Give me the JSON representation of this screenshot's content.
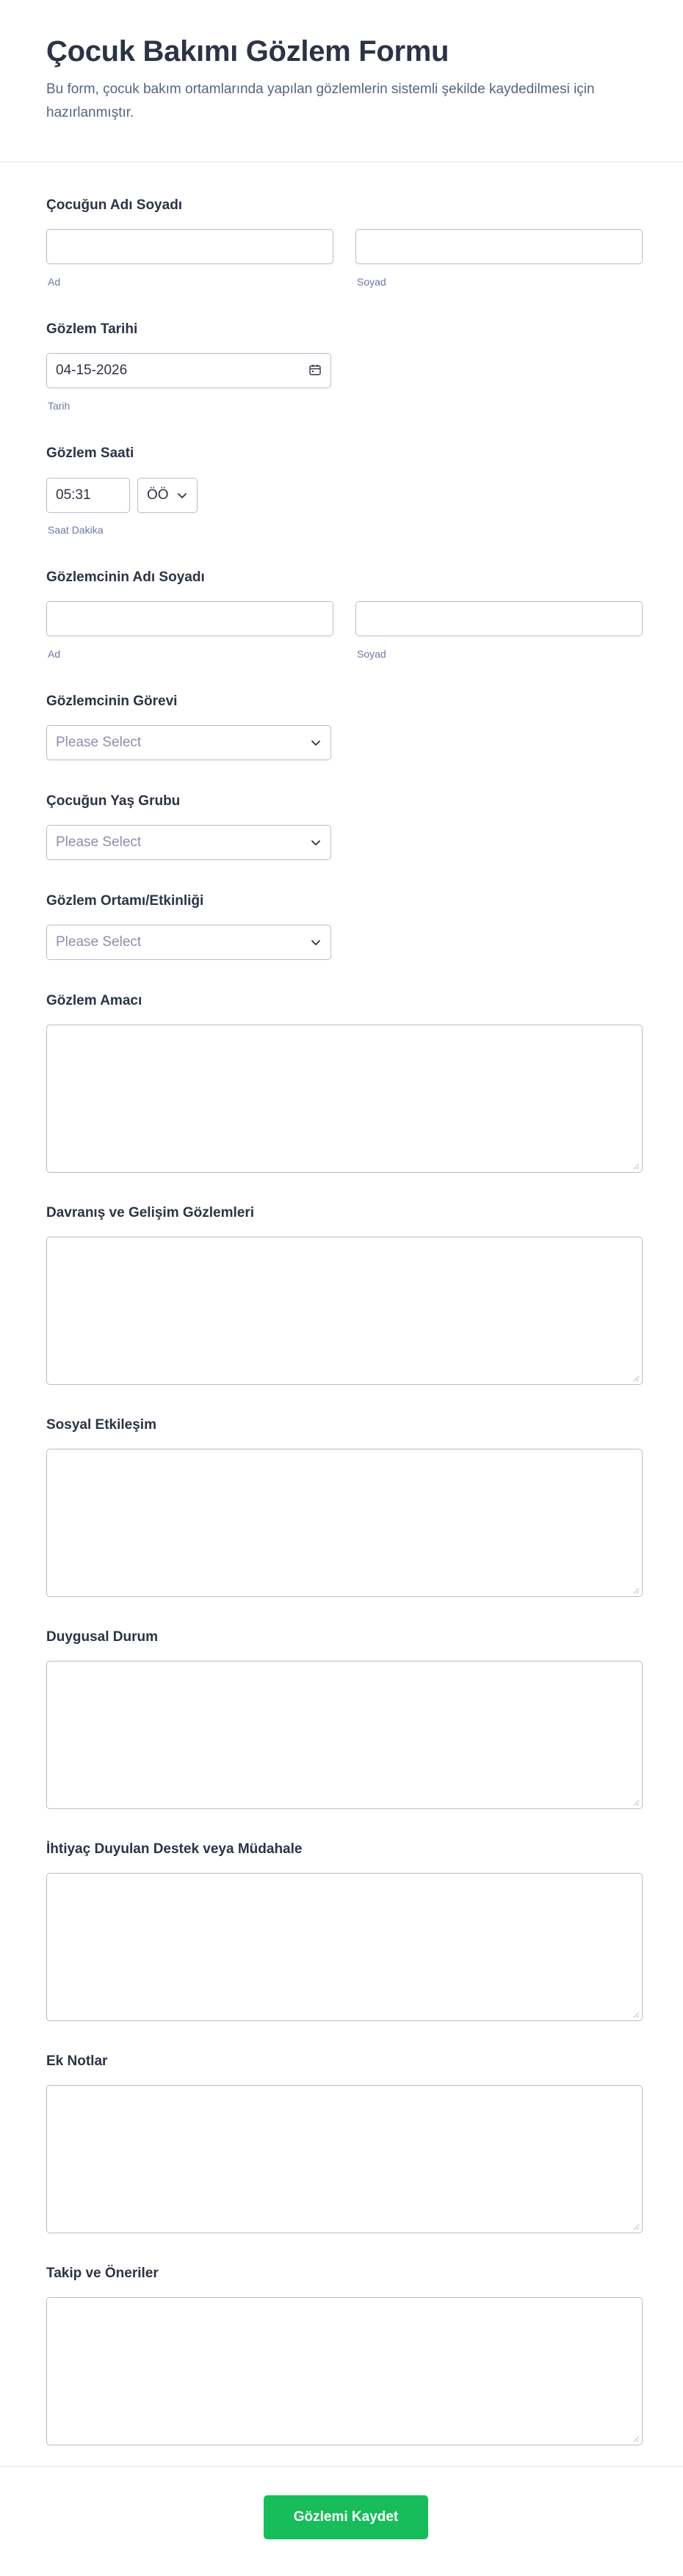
{
  "form": {
    "title": "Çocuk Bakımı Gözlem Formu",
    "description": "Bu form, çocuk bakım ortamlarında yapılan gözlemlerin sistemli şekilde kaydedilmesi için hazırlanmıştır."
  },
  "child_name": {
    "label": "Çocuğun Adı Soyadı",
    "first_sublabel": "Ad",
    "last_sublabel": "Soyad",
    "first_value": "",
    "last_value": ""
  },
  "observation_date": {
    "label": "Gözlem Tarihi",
    "value": "04-15-2026",
    "sublabel": "Tarih",
    "icon": "calendar-icon"
  },
  "observation_time": {
    "label": "Gözlem Saati",
    "value": "05:31",
    "ampm": "ÖÖ",
    "sublabel": "Saat Dakika"
  },
  "observer_name": {
    "label": "Gözlemcinin Adı Soyadı",
    "first_sublabel": "Ad",
    "last_sublabel": "Soyad",
    "first_value": "",
    "last_value": ""
  },
  "observer_role": {
    "label": "Gözlemcinin Görevi",
    "placeholder": "Please Select"
  },
  "child_age_group": {
    "label": "Çocuğun Yaş Grubu",
    "placeholder": "Please Select"
  },
  "setting": {
    "label": "Gözlem Ortamı/Etkinliği",
    "placeholder": "Please Select"
  },
  "textareas": [
    {
      "label": "Gözlem Amacı",
      "value": ""
    },
    {
      "label": "Davranış ve Gelişim Gözlemleri",
      "value": ""
    },
    {
      "label": "Sosyal Etkileşim",
      "value": ""
    },
    {
      "label": "Duygusal Durum",
      "value": ""
    },
    {
      "label": "İhtiyaç Duyulan Destek veya Müdahale",
      "value": ""
    },
    {
      "label": "Ek Notlar",
      "value": ""
    },
    {
      "label": "Takip ve Öneriler",
      "value": ""
    }
  ],
  "submit": {
    "label": "Gözlemi Kaydet",
    "color": "#18bd5b"
  }
}
